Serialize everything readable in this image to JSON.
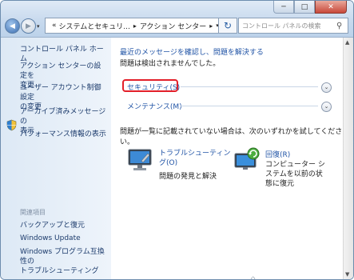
{
  "toolbar": {
    "breadcrumb_root": "システムとセキュリ...",
    "breadcrumb_current": "アクション センター",
    "search_placeholder": "コントロール パネルの検索"
  },
  "sidebar": {
    "home": "コントロール パネル ホーム",
    "items": [
      {
        "label_lines": [
          "アクション センターの設定を",
          "変更"
        ]
      },
      {
        "label_lines": [
          "ユーザー アカウント制御設定",
          "の変更"
        ]
      },
      {
        "label_lines": [
          "アーカイブ済みメッセージの",
          "表示"
        ]
      },
      {
        "label_lines": [
          "パフォーマンス情報の表示"
        ]
      }
    ],
    "related_heading": "関連項目",
    "related": [
      {
        "label_lines": [
          "バックアップと復元"
        ]
      },
      {
        "label_lines": [
          "Windows Update"
        ]
      },
      {
        "label_lines": [
          "Windows プログラム互換性の",
          "トラブルシューティング"
        ]
      }
    ]
  },
  "main": {
    "top_link": "最近のメッセージを確認し、問題を解決する",
    "status": "問題は検出されませんでした。",
    "sections": [
      {
        "label": "セキュリティ(S)"
      },
      {
        "label": "メンテナンス(M)"
      }
    ],
    "hint": "問題が一覧に記載されていない場合は、次のいずれかを試してください。",
    "tools": [
      {
        "title_lines": [
          "トラブルシューティン",
          "グ(O)"
        ],
        "desc_lines": [
          "問題の発見と解決"
        ]
      },
      {
        "title_lines": [
          "回復(R)"
        ],
        "desc_lines": [
          "コンピューター シ",
          "ステムを以前の状",
          "態に復元"
        ]
      }
    ]
  },
  "colors": {
    "accent": "#2154a6",
    "highlight": "#e3202a"
  }
}
